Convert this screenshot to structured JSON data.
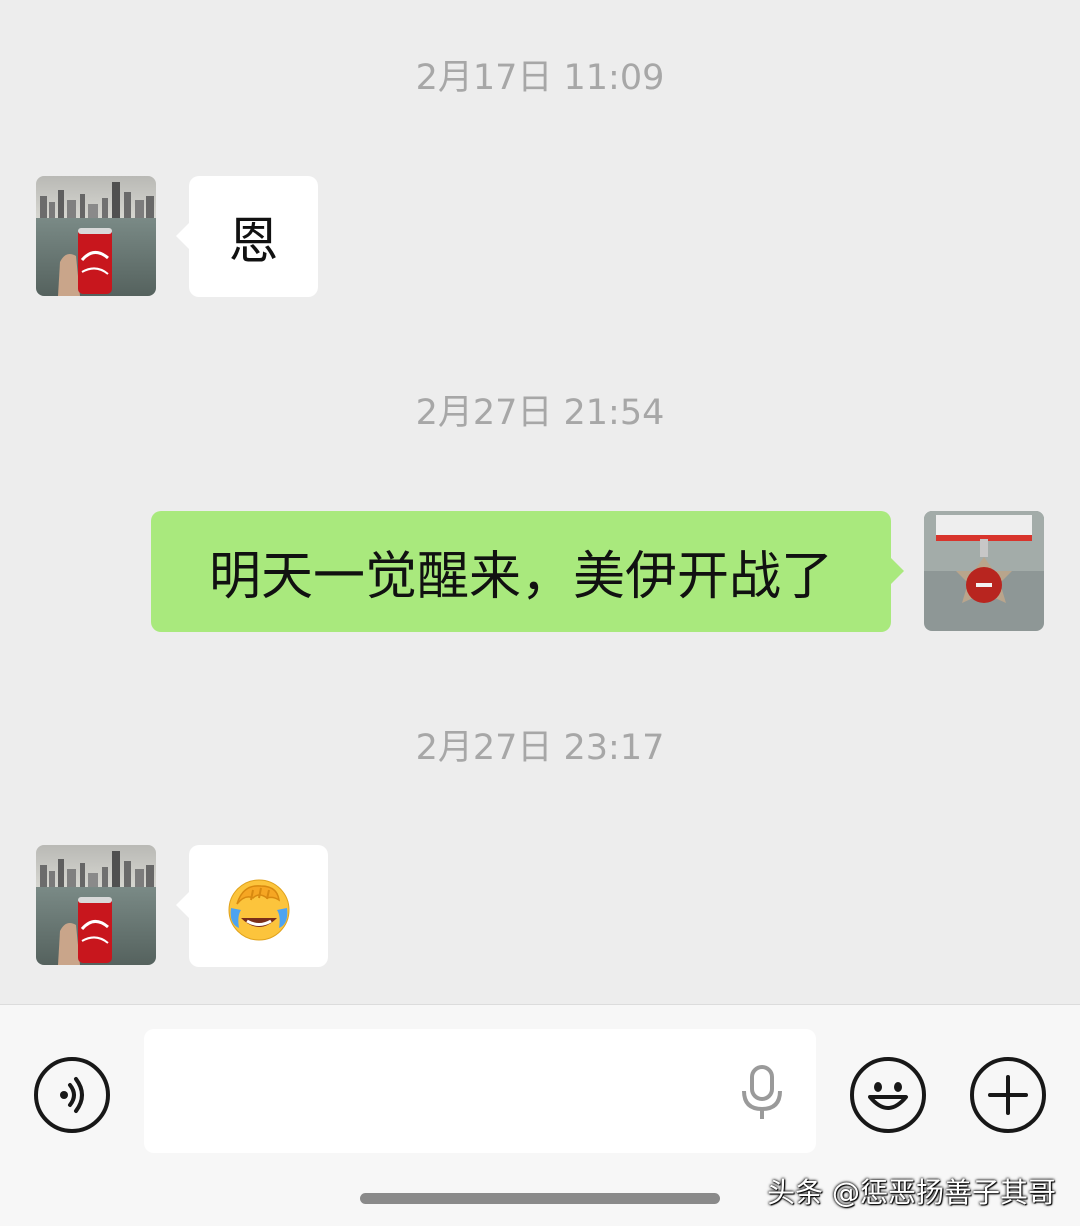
{
  "messages": [
    {
      "timestamp": "2月17日 11:09",
      "sender": "contact",
      "text": "恩"
    },
    {
      "timestamp": "2月27日 21:54",
      "sender": "me",
      "text": "明天一觉醒来，美伊开战了"
    },
    {
      "timestamp": "2月27日 23:17",
      "sender": "contact",
      "emoji": "facepalm-laughing-emoji"
    }
  ],
  "contact": {
    "avatar_icon": "coca-cola-can-city-photo"
  },
  "me": {
    "avatar_icon": "medal-photo"
  },
  "input_bar": {
    "voice_icon": "voice-mode-icon",
    "mic_icon": "microphone-icon",
    "emoji_icon": "smiley-icon",
    "more_icon": "plus-icon"
  },
  "watermark": "头条 @惩恶扬善子其哥",
  "colors": {
    "background": "#ededed",
    "incoming_bubble": "#ffffff",
    "outgoing_bubble": "#a9e97d",
    "timestamp_text": "#a7a7a7"
  }
}
